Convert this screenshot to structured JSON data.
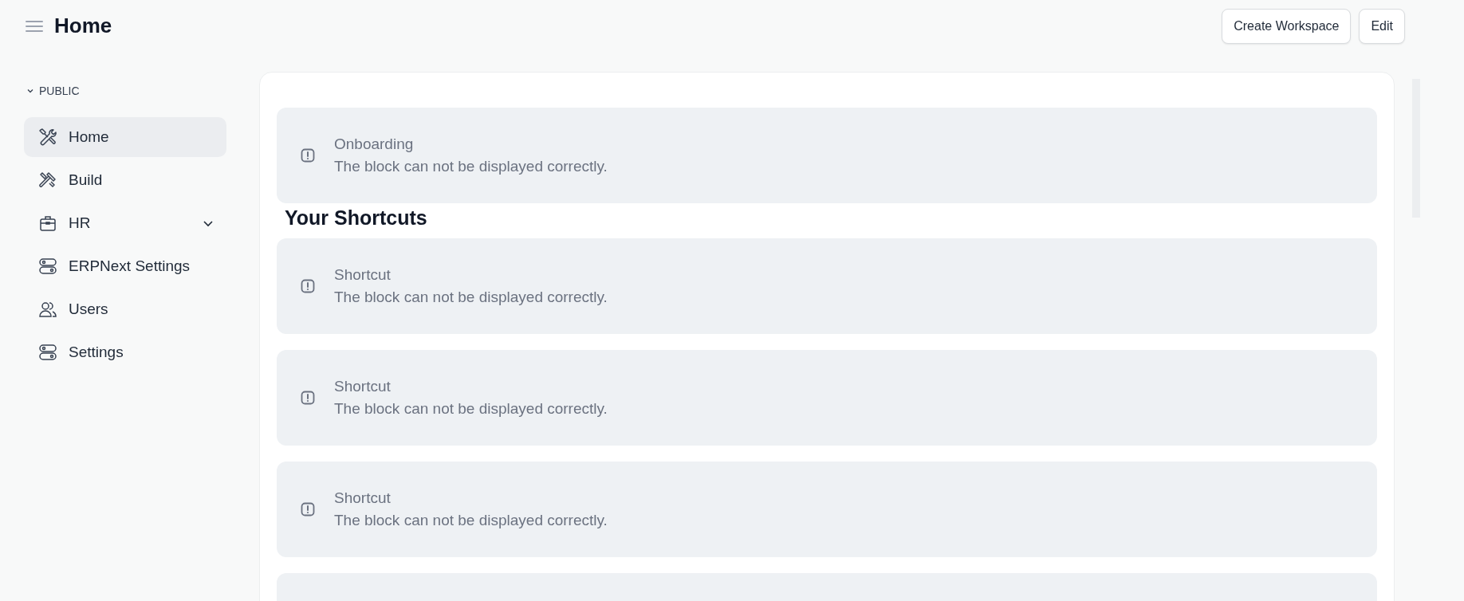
{
  "header": {
    "title": "Home",
    "buttons": [
      "Create Workspace",
      "Edit"
    ]
  },
  "sidebar": {
    "section": "PUBLIC",
    "items": [
      {
        "label": "Home",
        "kind": "tools",
        "selected": true,
        "expandable": false
      },
      {
        "label": "Build",
        "kind": "hammer",
        "selected": false,
        "expandable": false
      },
      {
        "label": "HR",
        "kind": "briefcase",
        "selected": false,
        "expandable": true
      },
      {
        "label": "ERPNext Settings",
        "kind": "toggles",
        "selected": false,
        "expandable": false
      },
      {
        "label": "Users",
        "kind": "users",
        "selected": false,
        "expandable": false
      },
      {
        "label": "Settings",
        "kind": "toggles",
        "selected": false,
        "expandable": false
      }
    ]
  },
  "content": [
    {
      "kind": "block",
      "title": "Onboarding",
      "message": "The block can not be displayed correctly."
    },
    {
      "kind": "heading",
      "text": "Your Shortcuts"
    },
    {
      "kind": "block",
      "title": "Shortcut",
      "message": "The block can not be displayed correctly."
    },
    {
      "kind": "block",
      "title": "Shortcut",
      "message": "The block can not be displayed correctly."
    },
    {
      "kind": "block",
      "title": "Shortcut",
      "message": "The block can not be displayed correctly."
    },
    {
      "kind": "cut_block"
    }
  ]
}
